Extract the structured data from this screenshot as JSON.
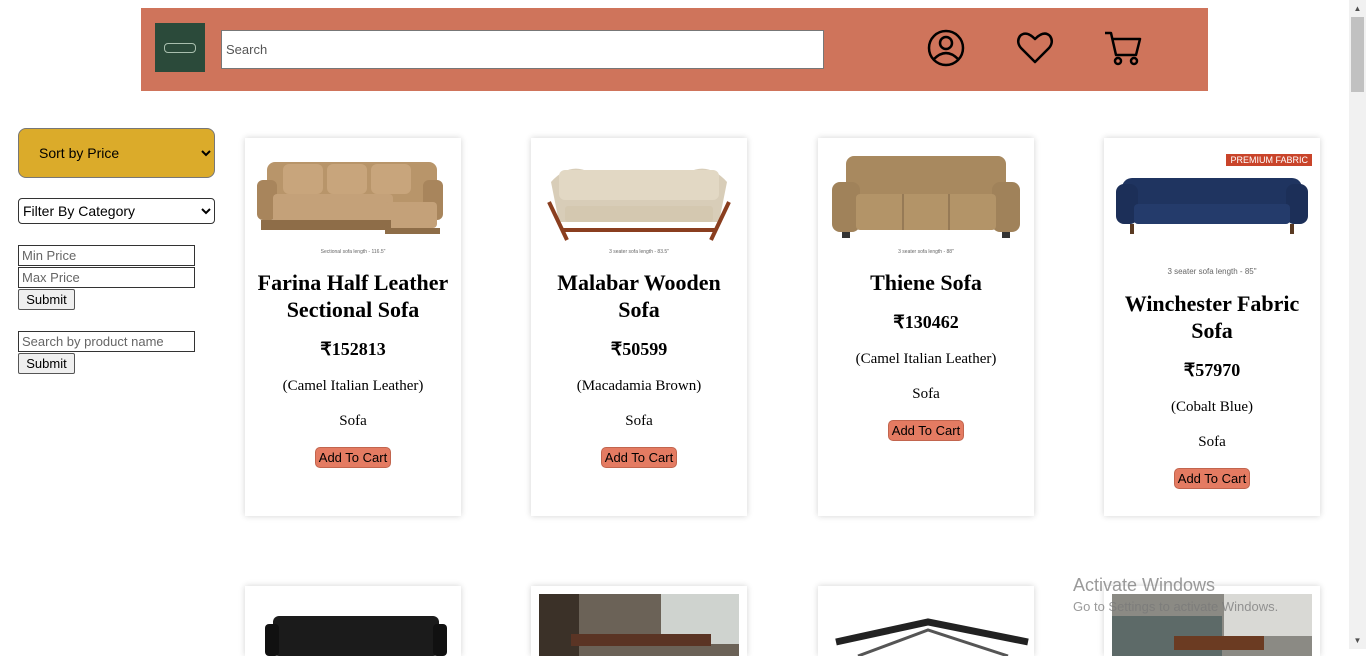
{
  "header": {
    "search_placeholder": "Search",
    "icons": [
      "user-account-icon",
      "wishlist-heart-icon",
      "shopping-cart-icon"
    ],
    "background_color": "#cf745b"
  },
  "sidebar": {
    "sort_label": "Sort by Price",
    "category_label": "Filter By Category",
    "min_price_placeholder": "Min Price",
    "max_price_placeholder": "Max Price",
    "submit_label": "Submit",
    "name_search_placeholder": "Search by product name",
    "submit2_label": "Submit",
    "sort_color": "#dbab2a"
  },
  "products": [
    {
      "name": "Farina Half Leather Sectional Sofa",
      "price": "₹152813",
      "variant": "(Camel Italian Leather)",
      "category": "Sofa",
      "button": "Add To Cart",
      "image_caption": "Sectional sofa length - 116.5\""
    },
    {
      "name": "Malabar Wooden Sofa",
      "price": "₹50599",
      "variant": "(Macadamia Brown)",
      "category": "Sofa",
      "button": "Add To Cart",
      "image_caption": "3 seater sofa length - 83.5\""
    },
    {
      "name": "Thiene Sofa",
      "price": "₹130462",
      "variant": "(Camel Italian Leather)",
      "category": "Sofa",
      "button": "Add To Cart",
      "image_caption": "3 seater sofa length - 88\""
    },
    {
      "name": "Winchester Fabric Sofa",
      "price": "₹57970",
      "variant": "(Cobalt Blue)",
      "category": "Sofa",
      "button": "Add To Cart",
      "image_caption": "3 seater sofa length - 85\"",
      "badge": "PREMIUM FABRIC"
    }
  ],
  "watermark": {
    "title": "Activate Windows",
    "subtitle": "Go to Settings to activate Windows."
  }
}
